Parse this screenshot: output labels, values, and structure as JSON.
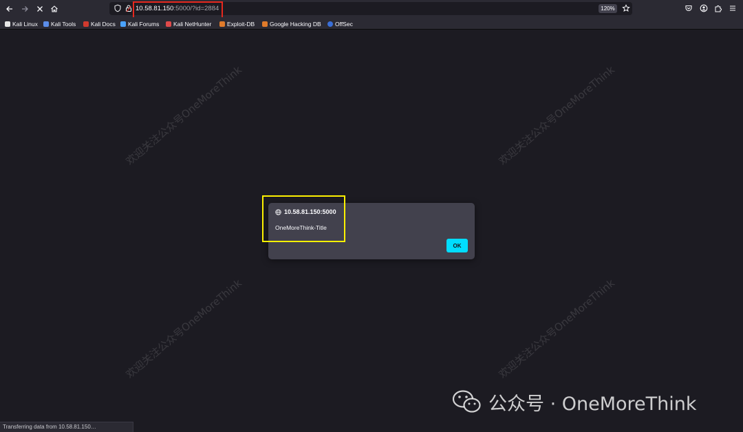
{
  "browser": {
    "url_host": "10.58.81.150",
    "url_rest": ":5000/?id=2884",
    "zoom": "120%",
    "bookmarks": [
      {
        "label": "Kali Linux",
        "icon": "kali-dragon-icon",
        "color": "#e6e6e6"
      },
      {
        "label": "Kali Tools",
        "icon": "kali-tools-icon",
        "color": "#5b8de8"
      },
      {
        "label": "Kali Docs",
        "icon": "kali-docs-icon",
        "color": "#d03a2e"
      },
      {
        "label": "Kali Forums",
        "icon": "kali-forums-icon",
        "color": "#4aa3ff"
      },
      {
        "label": "Kali NetHunter",
        "icon": "nethunter-icon",
        "color": "#e04a4a"
      },
      {
        "label": "Exploit-DB",
        "icon": "exploit-db-icon",
        "color": "#e07b2a"
      },
      {
        "label": "Google Hacking DB",
        "icon": "ghdb-icon",
        "color": "#e07b2a"
      },
      {
        "label": "OffSec",
        "icon": "offsec-icon",
        "color": "#3a6fd8"
      }
    ],
    "status": "Transferring data from 10.58.81.150…"
  },
  "dialog": {
    "origin": "10.58.81.150:5000",
    "message": "OneMoreThink-Title",
    "ok_label": "OK"
  },
  "watermark_text": "欢迎关注公众号OneMoreThink",
  "brand": {
    "text": "公众号 · OneMoreThink",
    "icon": "wechat-icon"
  },
  "colors": {
    "url_highlight": "#e8281e",
    "dialog_highlight": "#fff200",
    "accent": "#00ddff"
  }
}
